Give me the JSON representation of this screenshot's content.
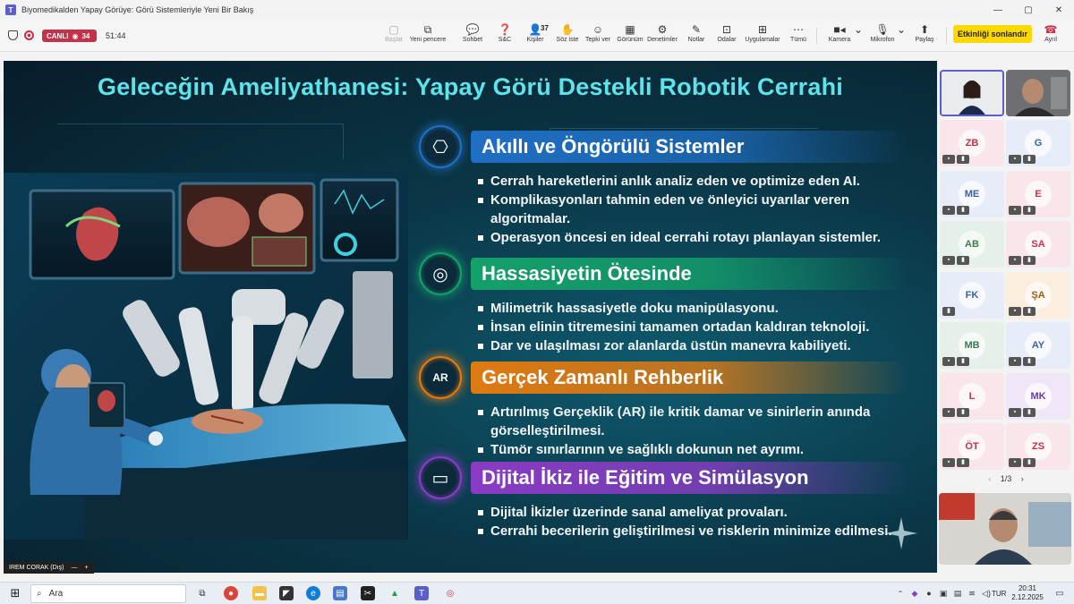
{
  "window": {
    "title": "Biyomedikalden Yapay Görüye: Görü Sistemleriyle Yeni Bir Bakış",
    "minimize": "—",
    "maximize": "▢",
    "close": "✕"
  },
  "meeting": {
    "live_label": "CANLI",
    "viewers": "34",
    "elapsed": "51:44",
    "toolbar": [
      {
        "name": "start-button",
        "label": "Başlat",
        "icon": "▢",
        "disabled": true
      },
      {
        "name": "new-window-button",
        "label": "Yeni pencere",
        "icon": "⧉",
        "disabled": false
      },
      {
        "name": "chat-button",
        "label": "Sohbet",
        "icon": "💬",
        "disabled": false
      },
      {
        "name": "qa-button",
        "label": "S&C",
        "icon": "❓",
        "disabled": false
      },
      {
        "name": "people-button",
        "label": "Kişiler",
        "icon": "👤",
        "badge": "37",
        "disabled": false
      },
      {
        "name": "raise-hand-button",
        "label": "Söz iste",
        "icon": "✋",
        "disabled": false
      },
      {
        "name": "react-button",
        "label": "Tepki ver",
        "icon": "☺",
        "disabled": false
      },
      {
        "name": "view-button",
        "label": "Görünüm",
        "icon": "▦",
        "disabled": false
      },
      {
        "name": "controls-button",
        "label": "Denetimler",
        "icon": "⚙",
        "disabled": false
      },
      {
        "name": "notes-button",
        "label": "Notlar",
        "icon": "✎",
        "disabled": false
      },
      {
        "name": "rooms-button",
        "label": "Odalar",
        "icon": "⊡",
        "disabled": false
      },
      {
        "name": "apps-button",
        "label": "Uygulamalar",
        "icon": "⊞",
        "disabled": false
      },
      {
        "name": "more-button",
        "label": "Tümü",
        "icon": "⋯",
        "disabled": false
      }
    ],
    "camera_label": "Kamera",
    "mic_label": "Mikrofon",
    "share_label": "Paylaş",
    "end_event_label": "Etkinliği sonlandır",
    "leave_label": "Ayrıl"
  },
  "slide": {
    "title": "Geleceğin Ameliyathanesi: Yapay Görü Destekli Robotik Cerrahi",
    "sections": [
      {
        "heading": "Akıllı ve Öngörülü Sistemler",
        "icon": "brain-icon",
        "color": "#1f6fc4",
        "bullets": [
          "Cerrah hareketlerini anlık analiz eden ve optimize eden AI.",
          "Komplikasyonları tahmin eden ve önleyici uyarılar veren algoritmalar.",
          "Operasyon öncesi en ideal cerrahi rotayı planlayan sistemler."
        ]
      },
      {
        "heading": "Hassasiyetin Ötesinde",
        "icon": "target-icon",
        "color": "#14a06a",
        "bullets": [
          "Milimetrik hassasiyetle doku manipülasyonu.",
          "İnsan elinin titremesini tamamen ortadan kaldıran teknoloji.",
          "Dar ve ulaşılması zor alanlarda üstün manevra kabiliyeti."
        ]
      },
      {
        "heading": "Gerçek Zamanlı Rehberlik",
        "icon": "ar-icon",
        "icon_text": "AR",
        "color": "#e07a12",
        "bullets": [
          "Artırılmış Gerçeklik (AR) ile kritik damar ve sinirlerin anında görselleştirilmesi.",
          "Tümör sınırlarının ve sağlıklı dokunun net ayrımı."
        ]
      },
      {
        "heading": "Dijital İkiz ile Eğitim ve Simülasyon",
        "icon": "vr-headset-icon",
        "color": "#8a3cc4",
        "bullets": [
          "Dijital İkizler üzerinde sanal ameliyat provaları.",
          "Cerrahi becerilerin geliştirilmesi ve risklerin minimize edilmesi."
        ]
      }
    ]
  },
  "presenter_tag": "IREM CORAK (Dış)",
  "participants": [
    {
      "initials": "ZB",
      "color": "#f8e6ea",
      "text": "#c4314b"
    },
    {
      "initials": "G",
      "color": "#e6edf8",
      "text": "#3a5fa8"
    },
    {
      "initials": "ME",
      "color": "#e6edf8",
      "text": "#3a5fa8"
    },
    {
      "initials": "E",
      "color": "#f8e6ea",
      "text": "#c4314b"
    },
    {
      "initials": "AB",
      "color": "#e4f0e8",
      "text": "#3d7a52"
    },
    {
      "initials": "SA",
      "color": "#f8e6ea",
      "text": "#c4314b"
    },
    {
      "initials": "FK",
      "color": "#e6edf8",
      "text": "#3a5fa8"
    },
    {
      "initials": "ŞA",
      "color": "#fbeede",
      "text": "#a05a14"
    },
    {
      "initials": "MB",
      "color": "#e4f0e8",
      "text": "#3d7a52"
    },
    {
      "initials": "AY",
      "color": "#e6edf8",
      "text": "#3a5fa8"
    },
    {
      "initials": "L",
      "color": "#f8e6ea",
      "text": "#c4314b"
    },
    {
      "initials": "MK",
      "color": "#efe6f8",
      "text": "#6a3ca8"
    },
    {
      "initials": "ÖT",
      "color": "#f8e6ea",
      "text": "#c4314b"
    },
    {
      "initials": "ZS",
      "color": "#f8e6ea",
      "text": "#c4314b"
    }
  ],
  "pager": "1/3",
  "taskbar": {
    "search_placeholder": "Ara",
    "lang": "TUR",
    "time": "20:31",
    "date": "2.12.2025"
  }
}
